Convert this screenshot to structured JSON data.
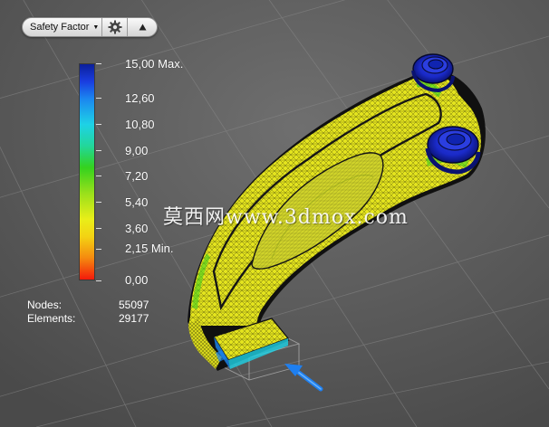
{
  "toolbar": {
    "result_label": "Safety Factor",
    "dropdown_icon": "caret-down-icon",
    "settings_icon": "gear-icon",
    "menu_icon": "triangle-up-icon"
  },
  "legend": {
    "labels": [
      "15,00 Max.",
      "12,60",
      "10,80",
      "9,00",
      "7,20",
      "5,40",
      "3,60",
      "2,15 Min.",
      "0,00"
    ],
    "colors": [
      "#0b1f9a",
      "#1b86f0",
      "#1ed2e6",
      "#34d21e",
      "#e9ee19",
      "#f58a0f",
      "#f31a0b"
    ]
  },
  "stats": {
    "nodes_label": "Nodes:",
    "nodes_value": "55097",
    "elements_label": "Elements:",
    "elements_value": "29177"
  },
  "watermark": "莫西网www.3dmox.com",
  "load_arrow_color": "#1e7ff0"
}
